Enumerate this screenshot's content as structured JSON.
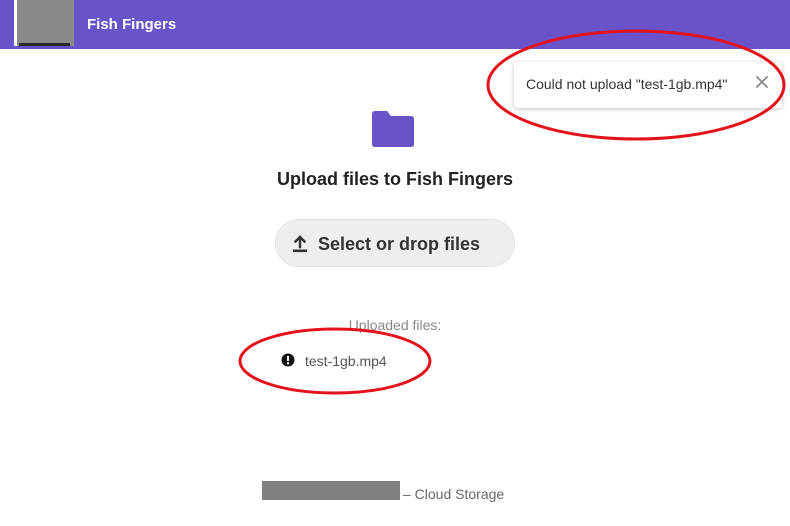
{
  "header": {
    "app_title": "Fish Fingers",
    "logo_icon": "app-logo-redacted",
    "background_color": "#6a52c9"
  },
  "toast": {
    "message": "Could not upload \"test-1gb.mp4\"",
    "close_icon": "close-icon"
  },
  "main": {
    "folder_icon": "folder-icon",
    "folder_color": "#6a52c9",
    "title": "Upload files to Fish Fingers",
    "select_button": {
      "icon": "upload-icon",
      "label": "Select or drop files"
    },
    "uploaded_files_label": "Uploaded files:",
    "files": [
      {
        "name": "test-1gb.mp4",
        "status_icon": "error-icon"
      }
    ]
  },
  "footer": {
    "text": "– Cloud Storage"
  },
  "annotations": {
    "color": "#e3121b"
  }
}
